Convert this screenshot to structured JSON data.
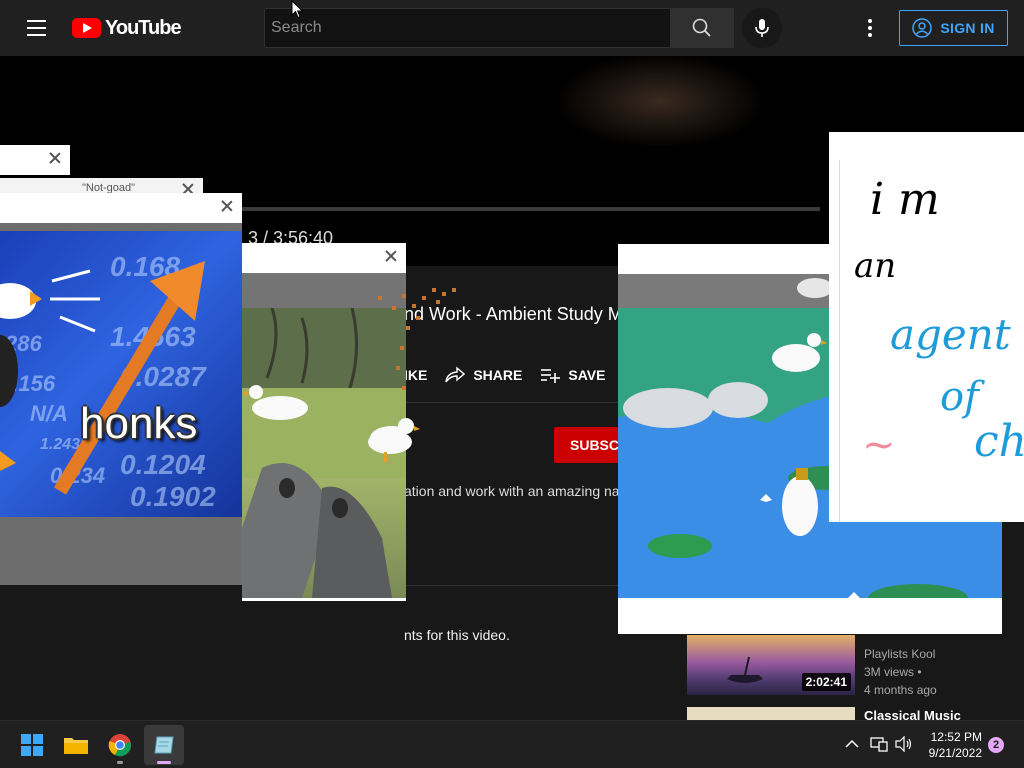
{
  "header": {
    "logo_text": "YouTube",
    "search_placeholder": "Search",
    "sign_in_label": "SIGN IN"
  },
  "player": {
    "timecode": "3 / 3:56:40"
  },
  "video": {
    "title": "nd Work - Ambient Study M",
    "like_label": "IKE",
    "share_label": "SHARE",
    "save_label": "SAVE",
    "subscribe_label": "SUBSC",
    "description": "ation and work with an amazing na",
    "comments_note": "nts for this video."
  },
  "recommendations": [
    {
      "title": "",
      "channel": "Playlists Kool",
      "views": "3M views •",
      "age": "4 months ago",
      "duration": "2:02:41"
    },
    {
      "title": "Classical Music",
      "channel": "",
      "views": "",
      "age": "",
      "duration": ""
    }
  ],
  "overlays": {
    "stonks_caption": "honks",
    "not_goad_text": "\"Not-goad\"",
    "tickers": [
      "0.168",
      "1.4563",
      "0.0287",
      "0.1204",
      "0.1902",
      "0.234",
      "0.156",
      "N/A",
      "286",
      "1.243"
    ],
    "handwriting": [
      "i m",
      "an",
      "agent",
      "of",
      "ch",
      "~"
    ]
  },
  "taskbar": {
    "time": "12:52 PM",
    "date": "9/21/2022",
    "notification_count": "2"
  },
  "colors": {
    "yt_red": "#ff0000",
    "sign_in_blue": "#3ea6ff",
    "subscribe_red": "#cc0000"
  }
}
